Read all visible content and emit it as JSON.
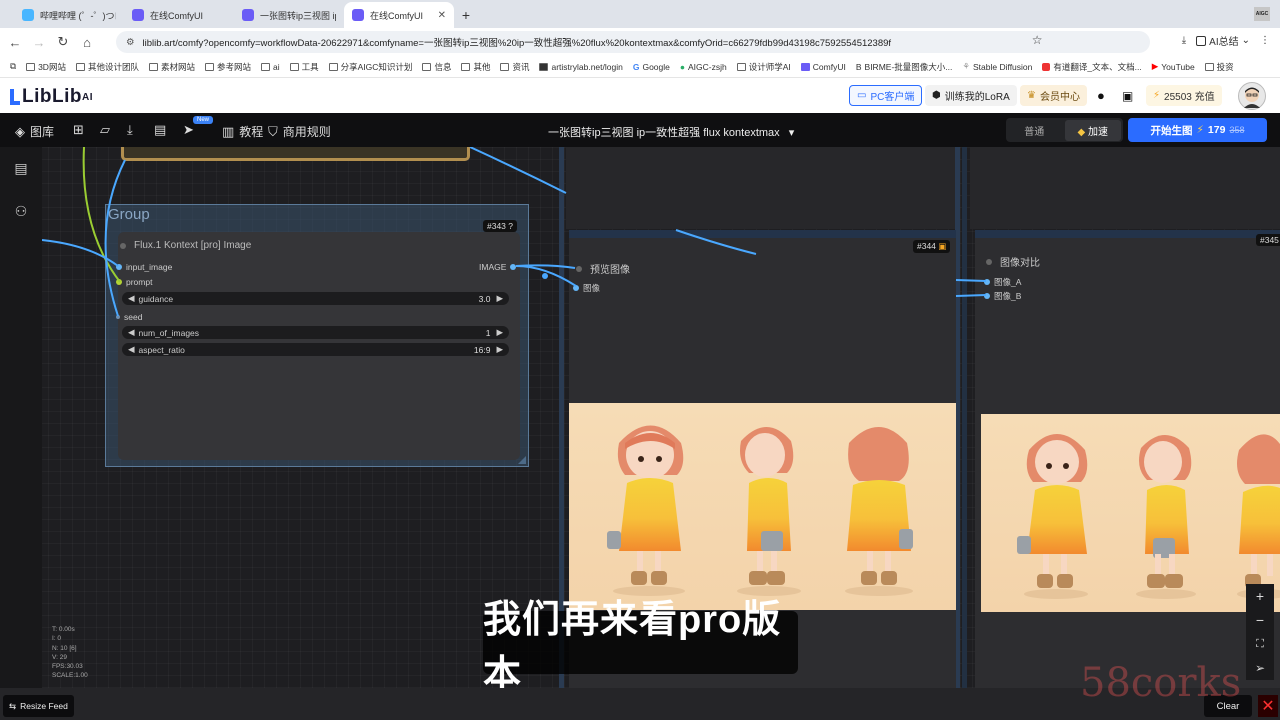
{
  "browser": {
    "tabs": [
      {
        "label": "哔哩哔哩 (゜-゜)つロ",
        "color": "#49b6ff",
        "active": false
      },
      {
        "label": "在线ComfyUI",
        "color": "#6b5cf6",
        "active": false
      },
      {
        "label": "一张图转ip三视图 ip一",
        "color": "#6b5cf6",
        "active": false
      },
      {
        "label": "在线ComfyUI",
        "color": "#6b5cf6",
        "active": true
      }
    ],
    "new_tab": "+",
    "ext_label": "AIGC",
    "url": "liblib.art/comfy?opencomfy=workflowData-20622971&comfyname=一张图转ip三视图%20ip一致性超强%20flux%20kontextmax&comfyOrid=c66279fdb99d43198c7592554512389f",
    "ai_summary": "AI总结",
    "bookmarks": [
      "3D网站",
      "其他设计团队",
      "素材网站",
      "参考网站",
      "ai",
      "工具",
      "分享AIGC知识计划",
      "信息",
      "其他",
      "资讯",
      "artistrylab.net/login",
      "Google",
      "AIGC-zsjh",
      "设计师学AI",
      "ComfyUI",
      "BIRME-批量图像大小...",
      "Stable Diffusion",
      "有道翻译_文本、文档...",
      "YouTube",
      "投资"
    ]
  },
  "header": {
    "logo": "LibLib",
    "logo_suffix": "AI",
    "pc_client": "PC客户端",
    "train_lora": "训练我的LoRA",
    "member": "会员中心",
    "points": "25503 充值"
  },
  "toolbar": {
    "library": "图库",
    "new_badge": "New",
    "tutorial": "教程",
    "rules": "商用规则",
    "workflow_title": "一张图转ip三视图 ip一致性超强 flux kontextmax",
    "mode_normal": "普通",
    "mode_fast": "加速",
    "run_label": "开始生图",
    "run_cost": "179",
    "run_cost_old": "358"
  },
  "canvas": {
    "group_title": "Group",
    "node343": {
      "id": "#343 ?",
      "title": "Flux.1 Kontext [pro] Image",
      "inputs": [
        "input_image",
        "prompt",
        "seed"
      ],
      "output": "IMAGE",
      "widgets": [
        {
          "name": "guidance",
          "value": "3.0"
        },
        {
          "name": "num_of_images",
          "value": "1"
        },
        {
          "name": "aspect_ratio",
          "value": "16:9"
        }
      ]
    },
    "node344": {
      "id": "#344",
      "title": "预览图像",
      "input": "图像"
    },
    "node345": {
      "id": "#345",
      "title": "图像对比",
      "inputs": [
        "图像_A",
        "图像_B"
      ]
    },
    "stats": [
      "T: 0.00s",
      "I: 0",
      "N: 10 [6]",
      "V: 29",
      "FPS:30.03",
      "SCALE:1.00"
    ]
  },
  "subtitle": "我们再来看pro版本",
  "bottom": {
    "resize_feed": "Resize Feed",
    "clear": "Clear"
  },
  "watermark": "58corks",
  "colors": {
    "accent": "#2b6cff",
    "wire_blue": "#4aa8ff",
    "wire_green": "#9acd32"
  }
}
